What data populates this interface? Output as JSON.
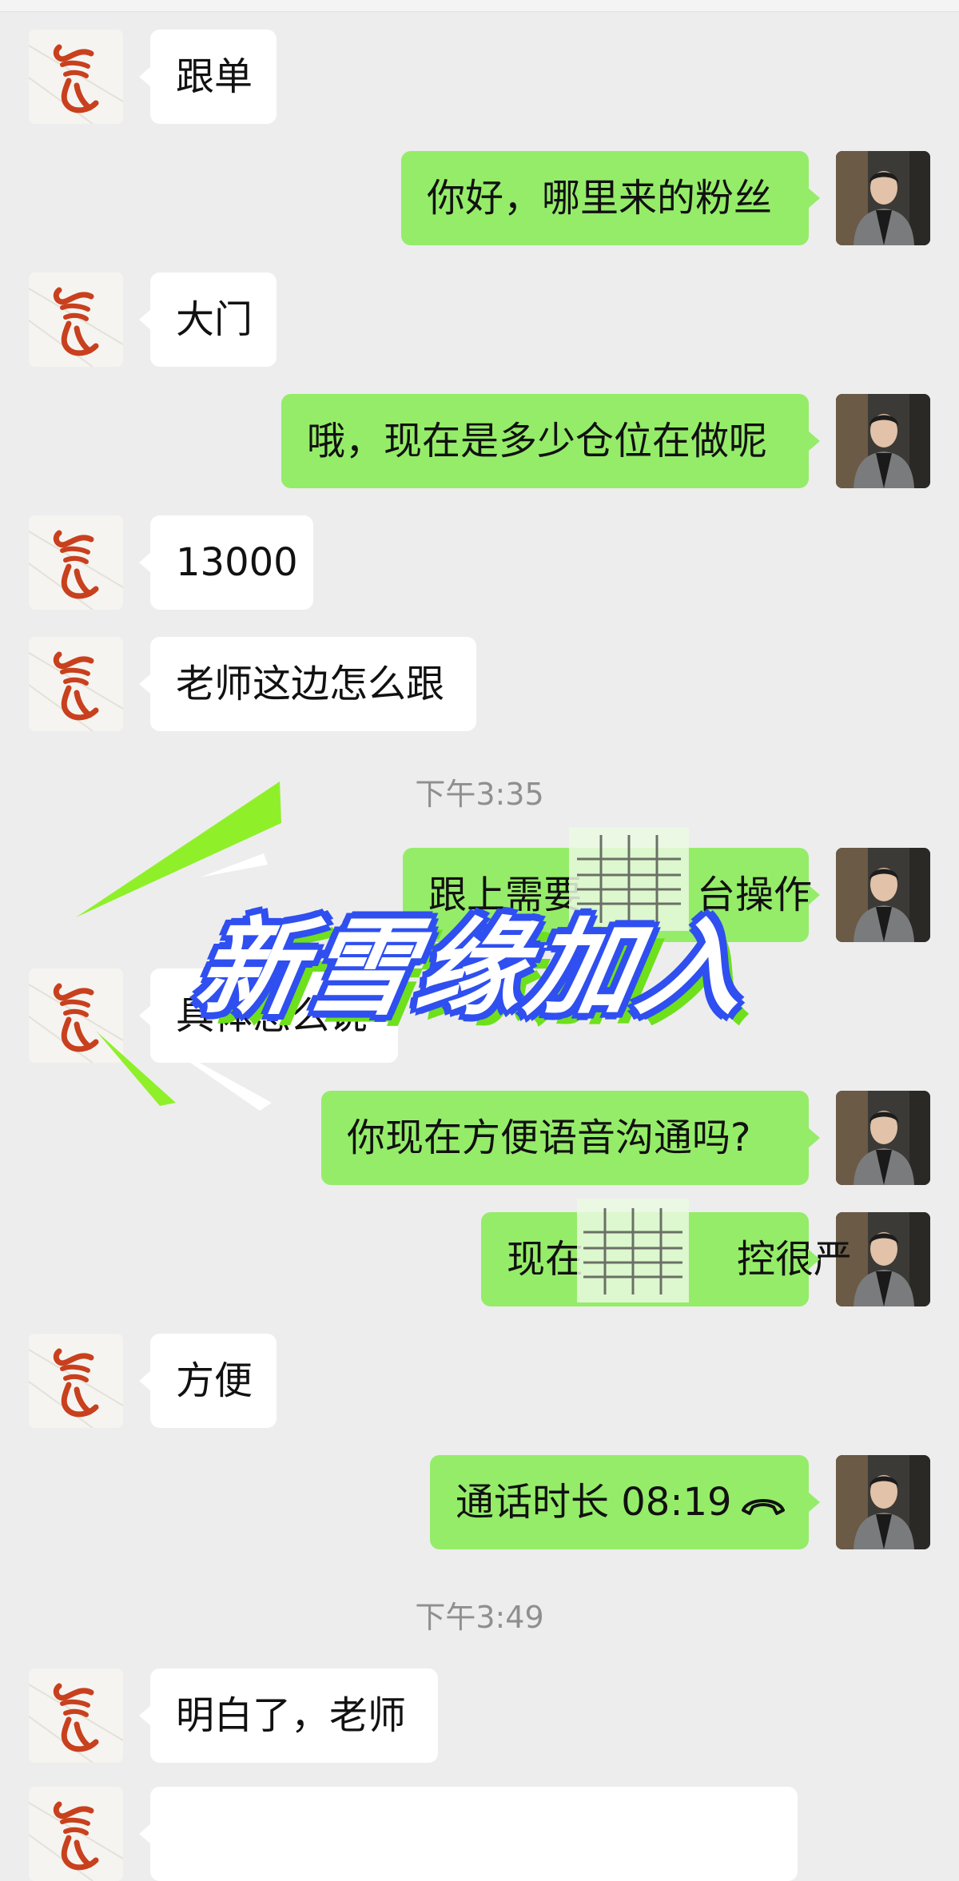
{
  "messages": [
    {
      "side": "left",
      "text": "跟单"
    },
    {
      "side": "right",
      "text": "你好，哪里来的粉丝"
    },
    {
      "side": "left",
      "text": "大门"
    },
    {
      "side": "right",
      "text": "哦，现在是多少仓位在做呢"
    },
    {
      "side": "left",
      "text": "13000"
    },
    {
      "side": "left",
      "text": "老师这边怎么跟"
    },
    {
      "time": "下午3:35"
    },
    {
      "side": "right",
      "text": "跟上需要　　　台操作"
    },
    {
      "side": "left",
      "text": "具体怎么说"
    },
    {
      "side": "right",
      "text": "你现在方便语音沟通吗?"
    },
    {
      "side": "right",
      "text": "现在　　　　控很严"
    },
    {
      "side": "left",
      "text": "方便"
    },
    {
      "side": "right",
      "text": "通话时长 08:19",
      "icon": "hang-up-phone-icon"
    },
    {
      "time": "下午3:49"
    },
    {
      "side": "left",
      "text": "明白了，老师"
    }
  ],
  "overlay_title": "新雪缘加入",
  "colors": {
    "background": "#ededed",
    "sent_bubble": "#95ec69",
    "received_bubble": "#ffffff",
    "title_fill": "#ffffff",
    "title_outline": "#2f4ff0",
    "title_shadow": "#6ee01c",
    "seal_red": "#c8401e"
  },
  "avatars": {
    "left": "red-seal-logo-avatar",
    "right": "man-in-suit-photo-avatar"
  }
}
